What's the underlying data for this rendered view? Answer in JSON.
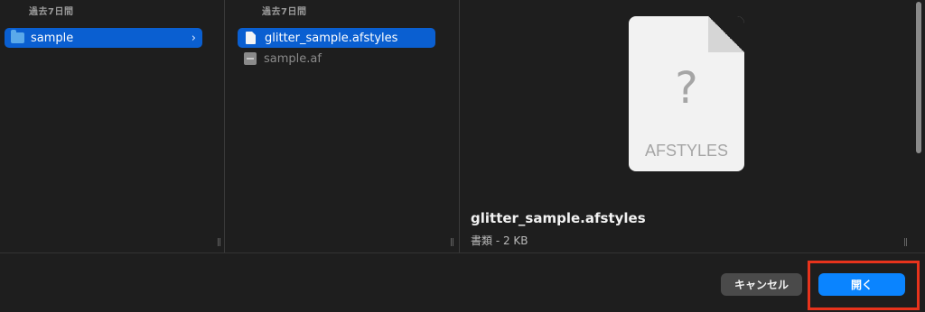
{
  "columns": {
    "col1": {
      "section_label": "過去7日間",
      "items": [
        {
          "label": "sample",
          "icon": "folder-icon",
          "selected": true
        }
      ]
    },
    "col2": {
      "section_label": "過去7日間",
      "items": [
        {
          "label": "glitter_sample.afstyles",
          "icon": "document-icon",
          "selected": true
        },
        {
          "label": "sample.af",
          "icon": "generic-file-icon",
          "selected": false
        }
      ]
    }
  },
  "preview": {
    "icon_glyph": "?",
    "icon_ext": "AFSTYLES",
    "file_name": "glitter_sample.afstyles",
    "file_meta": "書類 - 2 KB"
  },
  "footer": {
    "cancel_label": "キャンセル",
    "open_label": "開く"
  },
  "colors": {
    "accent": "#0a84ff",
    "selection": "#0a5fd1",
    "highlight": "#e8331c",
    "background": "#1e1e1e"
  }
}
